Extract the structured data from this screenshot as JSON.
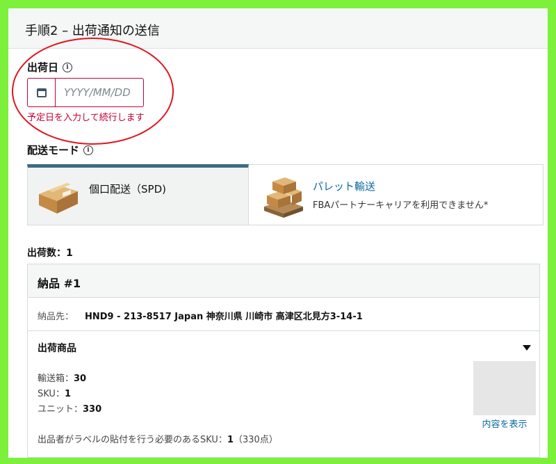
{
  "step": {
    "title": "手順2 – 出荷通知の送信"
  },
  "ship_date": {
    "label": "出荷日",
    "placeholder": "YYYY/MM/DD",
    "error": "予定日を入力して続行します"
  },
  "shipping_mode": {
    "label": "配送モード",
    "options": [
      {
        "title": "個口配送（SPD)",
        "subtitle": "",
        "selected": true
      },
      {
        "title": "パレット輸送",
        "subtitle": "FBAパートナーキャリアを利用できません*",
        "selected": false
      }
    ]
  },
  "shipments": {
    "count_label": "出荷数：1",
    "card": {
      "title": "納品 #1",
      "destination_label": "納品先：",
      "destination_value": "HND9 - 213-8517 Japan 神奈川県 川崎市 高津区北見方3-14-1",
      "products_title": "出荷商品",
      "boxes_label": "輸送箱：",
      "boxes_value": "30",
      "sku_label": "SKU：",
      "sku_value": "1",
      "units_label": "ユニット：",
      "units_value": "330",
      "show_contents": "内容を表示",
      "label_note_prefix": "出品者がラベルの貼付を行う必要のあるSKU：",
      "label_note_value": "1",
      "label_note_suffix": "（330点）"
    }
  },
  "colors": {
    "error_red": "#c40035",
    "annotation_red": "#e0141e",
    "selected_tab_bar": "#3f6b84",
    "link_blue": "#0a6aa1",
    "page_border_green": "#7cf03a"
  }
}
